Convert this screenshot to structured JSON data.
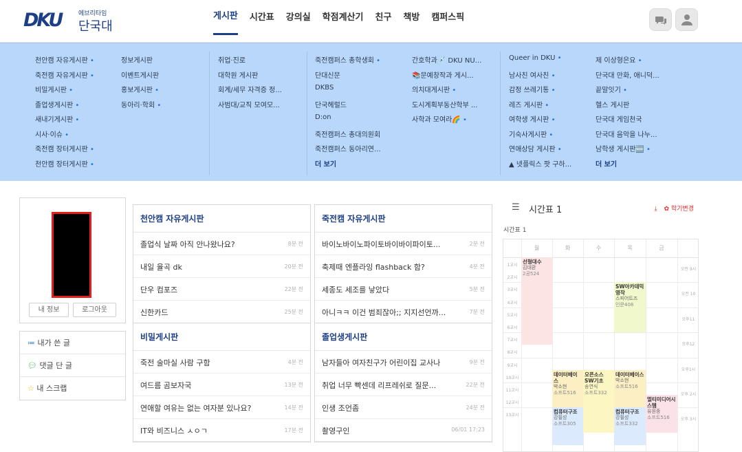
{
  "header": {
    "logo_mark": "DKU",
    "logo_sub": "에브리타임",
    "logo_name": "단국대",
    "nav": [
      "게시판",
      "시간표",
      "강의실",
      "학점계산기",
      "친구",
      "책방",
      "캠퍼스픽"
    ]
  },
  "menu": {
    "col1": [
      "천안캠 자유게시판",
      "죽전캠 자유게시판",
      "비밀게시판",
      "졸업생게시판",
      "새내기게시판",
      "시사·이슈",
      "죽전캠 장터게시판",
      "천안캠 장터게시판"
    ],
    "col1_dots": [
      1,
      1,
      1,
      1,
      1,
      1,
      1,
      1
    ],
    "col2": [
      "정보게시판",
      "이벤트게시판",
      "홍보게시판",
      "동아리·학회"
    ],
    "col2_dots": [
      0,
      0,
      1,
      1
    ],
    "col3": [
      "취업·진로",
      "대학원 게시판",
      "회계/세무 자격증 정...",
      "사범대/교직 모여모..."
    ],
    "col4": [
      "죽전캠퍼스 총학생회",
      "단대신문",
      "DKBS",
      "단국헤럴드",
      "D:on",
      "죽전캠퍼스 총대의원회",
      "죽전캠퍼스 동아리연..."
    ],
    "col4_dots": [
      1,
      0,
      0,
      0,
      0,
      0,
      0
    ],
    "col4_more": "더 보기",
    "col5": [
      "간호학과💉 DKU NU...",
      "📚문예창작과 게시...",
      "의치대게시판",
      "도시계획부동산학부 ...",
      "사학과 모여라🌈"
    ],
    "col5_dots": [
      0,
      0,
      1,
      0,
      1
    ],
    "col6": [
      "Queer in DKU",
      "남사친 여사친",
      "감정 쓰레기통",
      "레즈 게시판",
      "여학생 게시판",
      "기숙사게시판",
      "연애상담 게시판",
      "▲ 넷플릭스 팟 구하..."
    ],
    "col6_dots": [
      1,
      1,
      1,
      1,
      1,
      1,
      1,
      0
    ],
    "col7": [
      "제 이상형은요",
      "단국대 만화, 애니덕...",
      "끝말잇기",
      "헬스 게시판",
      "단국대 게임천국",
      "단국대 음악을 나누...",
      "남학생 게시판🆕"
    ],
    "col7_dots": [
      1,
      0,
      1,
      0,
      0,
      0,
      1
    ],
    "col7_more": "더 보기"
  },
  "profile": {
    "info_button": "내 정보",
    "logout_button": "로그아웃"
  },
  "mymenu": [
    "내가 쓴 글",
    "댓글 단 글",
    "내 스크랩"
  ],
  "boards": [
    {
      "title": "천안캠 자유게시판",
      "posts": [
        {
          "t": "졸업식 날짜 아직 안나왔나요?",
          "tm": "8분 전"
        },
        {
          "t": "내일 율곡 dk",
          "tm": "20분 전"
        },
        {
          "t": "단우 컴포즈",
          "tm": "22분 전"
        },
        {
          "t": "신한카드",
          "tm": "25분 전"
        }
      ]
    },
    {
      "title": "죽전캠 자유게시판",
      "posts": [
        {
          "t": "바이노바이노파이토바이바이파이토...",
          "tm": "2분 전"
        },
        {
          "t": "축제때 엔플라잉 flashback 함?",
          "tm": "4분 전"
        },
        {
          "t": "세종도 세조를 낳았다",
          "tm": "5분 전"
        },
        {
          "t": "아니ㅋㅋ 이건 범죄잖아;; 지지선언까...",
          "tm": "7분 전"
        }
      ]
    },
    {
      "title": "비밀게시판",
      "posts": [
        {
          "t": "죽전 술마실 사람 구함",
          "tm": "4분 전"
        },
        {
          "t": "여드름 곰보자국",
          "tm": "13분 전"
        },
        {
          "t": "연애할 여유는 없는 여자분 있나요?",
          "tm": "14분 전"
        },
        {
          "t": "IT와 비즈니스 ㅅㅇㄱ",
          "tm": "17분 전"
        }
      ]
    },
    {
      "title": "졸업생게시판",
      "posts": [
        {
          "t": "남자들아 여자친구가 어린이집 교사나",
          "tm": "9분 전"
        },
        {
          "t": "취업 너무 빡센데 리프레쉬로 질문...",
          "tm": "22분 전"
        },
        {
          "t": "인생 조언좀",
          "tm": "24분 전"
        },
        {
          "t": "촬영구인",
          "tm": "06/01 17:23"
        }
      ]
    }
  ],
  "timetable": {
    "title": "시간표 1",
    "subtitle": "시간표 1",
    "action": "학기변경",
    "days": [
      "월",
      "화",
      "수",
      "목",
      "금"
    ],
    "rows": [
      "1교시",
      "2교시",
      "3교시",
      "4교시",
      "5교시",
      "6교시",
      "7교시",
      "8교시",
      "9교시",
      "10교시",
      "11교시",
      "12교시",
      "13교시"
    ],
    "right_labels": [
      "오전 9시",
      "오전 10",
      "오후11",
      "오후12",
      "오후1시",
      "오후 2시",
      "오후 3시"
    ],
    "classes": [
      {
        "name": "선형대수",
        "prof": "김대환",
        "room": "2공524",
        "color": "#fce4e4"
      },
      {
        "name": "SW아카데믹영작",
        "prof": "스피어트즈",
        "room": "인문408",
        "color": "#f0f8cc"
      },
      {
        "name": "데이터베이스",
        "prof": "박소현",
        "room": "소프트516",
        "color": "#fcefc4"
      },
      {
        "name": "오픈소스SW기초",
        "prof": "송연식",
        "room": "소프트332",
        "color": "#fbf6c2"
      },
      {
        "name": "데이터베이스",
        "prof": "박소현",
        "room": "소프트516",
        "color": "#fcefc4"
      },
      {
        "name": "멀티미디어시스템",
        "prof": "유원종",
        "room": "소프트516",
        "color": "#fbe1e8"
      },
      {
        "name": "컴퓨터구조",
        "prof": "강필성",
        "room": "소프트305",
        "color": "#dbeafc"
      },
      {
        "name": "컴퓨터구조",
        "prof": "강필성",
        "room": "소프트332",
        "color": "#dbeafc"
      }
    ]
  }
}
